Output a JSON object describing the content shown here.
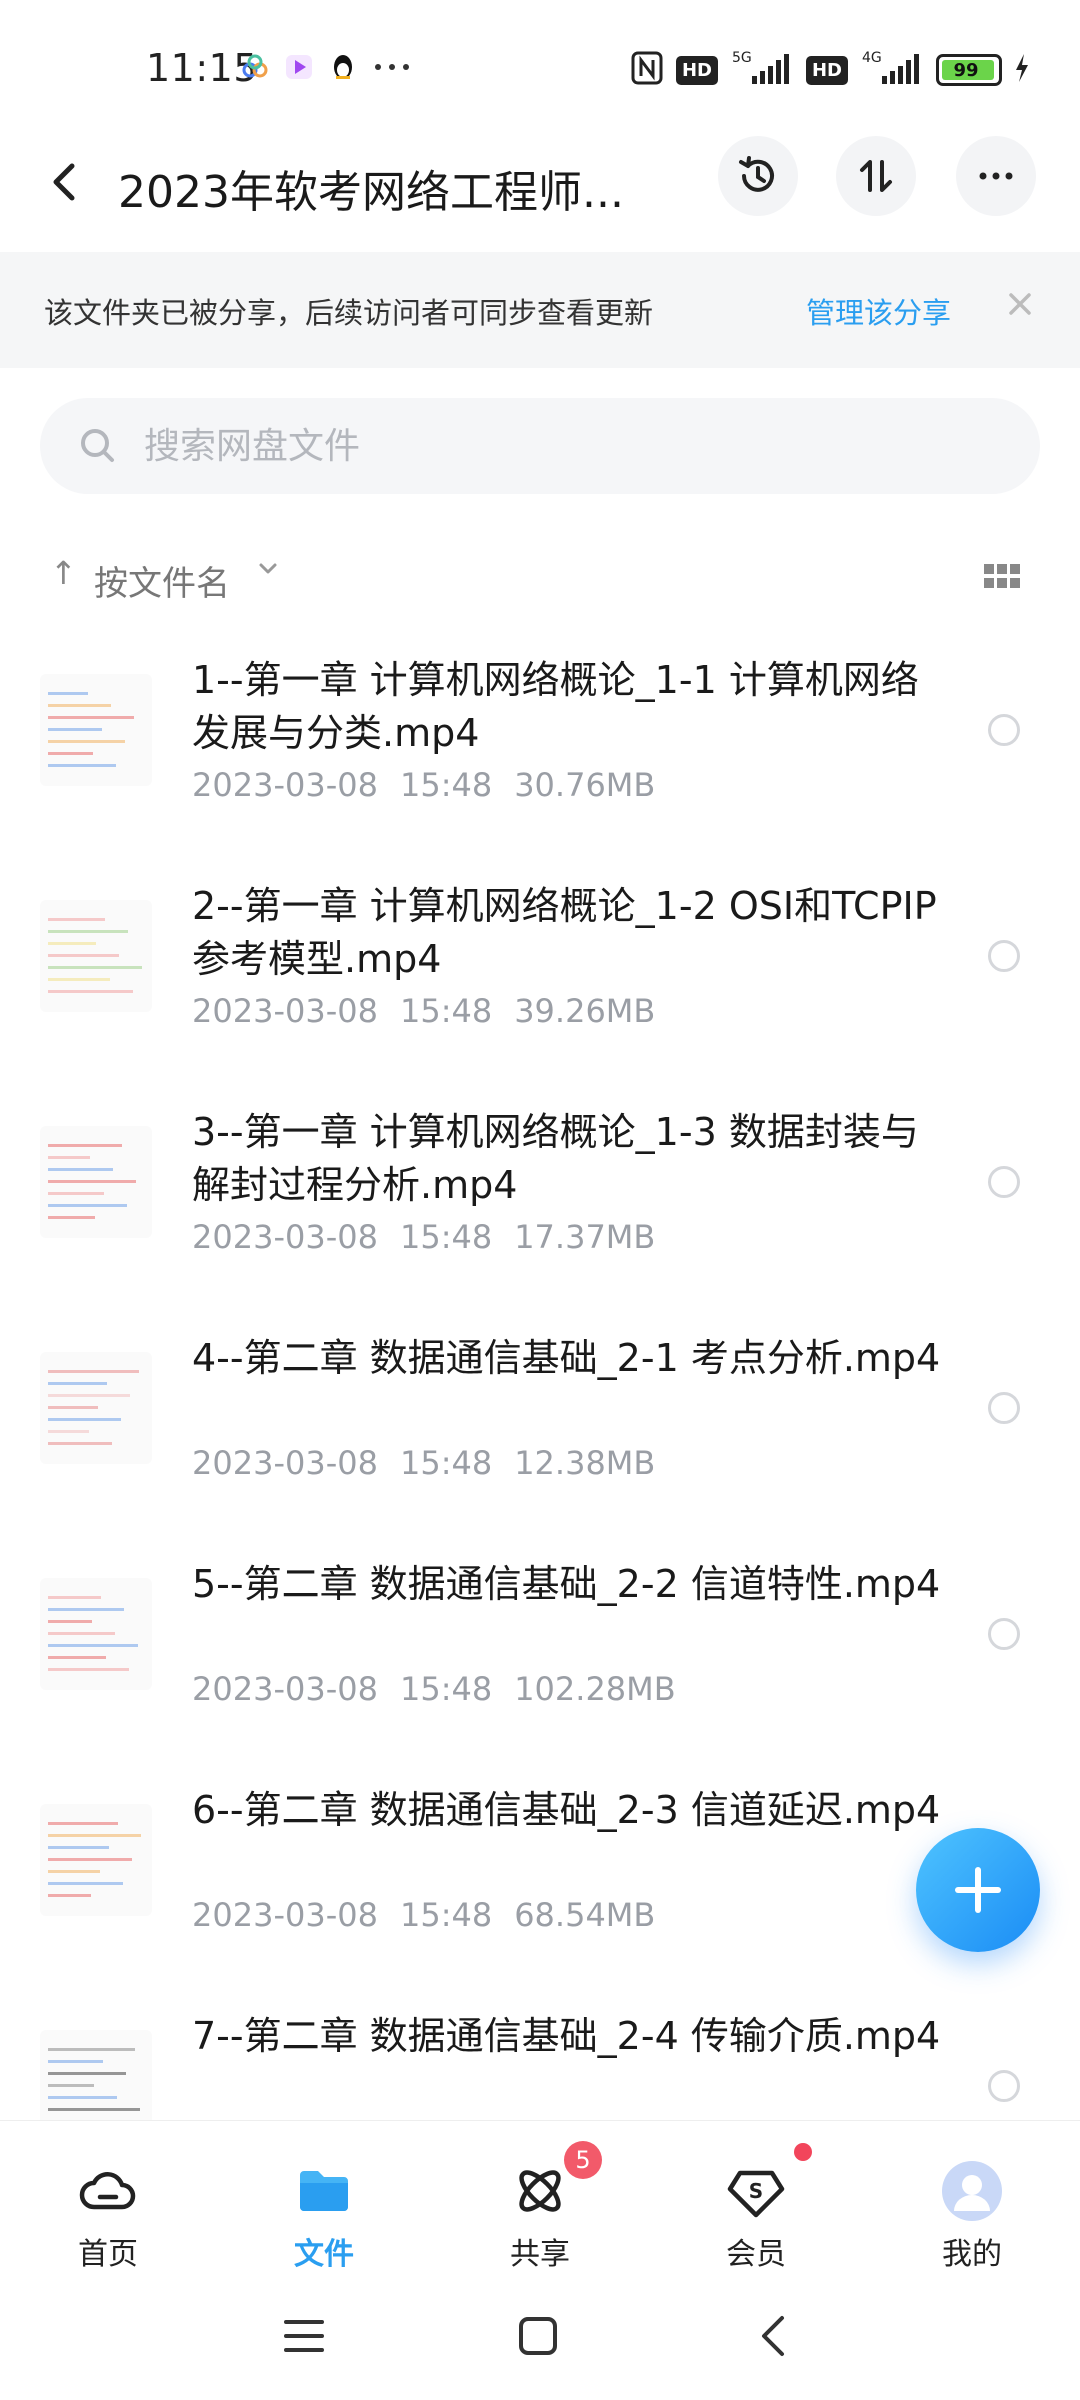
{
  "status_bar": {
    "time": "11:15",
    "network_5g": "5G",
    "network_4g": "4G",
    "hd": "HD",
    "battery": "99"
  },
  "header": {
    "title": "2023年软考网络工程师...",
    "icons": [
      "back-icon",
      "history-icon",
      "sort-swap-icon",
      "more-icon"
    ]
  },
  "share_banner": {
    "text": "该文件夹已被分享，后续访问者可同步查看更新",
    "manage_label": "管理该分享",
    "close_icon": "close-icon"
  },
  "search": {
    "placeholder": "搜索网盘文件"
  },
  "sort": {
    "arrow": "↑",
    "label": "按文件名",
    "caret": "⌄"
  },
  "files": [
    {
      "name": "1--第一章 计算机网络概论_1-1 计算机网络发展与分类.mp4",
      "date": "2023-03-08",
      "time": "15:48",
      "size": "30.76MB"
    },
    {
      "name": "2--第一章 计算机网络概论_1-2 OSI和TCPIP参考模型.mp4",
      "date": "2023-03-08",
      "time": "15:48",
      "size": "39.26MB"
    },
    {
      "name": "3--第一章 计算机网络概论_1-3 数据封装与解封过程分析.mp4",
      "date": "2023-03-08",
      "time": "15:48",
      "size": "17.37MB"
    },
    {
      "name": "4--第二章 数据通信基础_2-1 考点分析.mp4",
      "date": "2023-03-08",
      "time": "15:48",
      "size": "12.38MB"
    },
    {
      "name": "5--第二章 数据通信基础_2-2 信道特性.mp4",
      "date": "2023-03-08",
      "time": "15:48",
      "size": "102.28MB"
    },
    {
      "name": "6--第二章 数据通信基础_2-3 信道延迟.mp4",
      "date": "2023-03-08",
      "time": "15:48",
      "size": "68.54MB"
    },
    {
      "name": "7--第二章 数据通信基础_2-4 传输介质.mp4",
      "date": "",
      "time": "",
      "size": ""
    }
  ],
  "bottom_nav": {
    "items": [
      {
        "label": "首页",
        "icon": "cloud-home-icon"
      },
      {
        "label": "文件",
        "icon": "folder-icon"
      },
      {
        "label": "共享",
        "icon": "share-atom-icon",
        "badge": "5"
      },
      {
        "label": "会员",
        "icon": "vip-shield-icon"
      },
      {
        "label": "我的",
        "icon": "avatar-icon"
      }
    ]
  },
  "colors": {
    "accent": "#2a9ef0",
    "badge": "#f25a6a"
  }
}
